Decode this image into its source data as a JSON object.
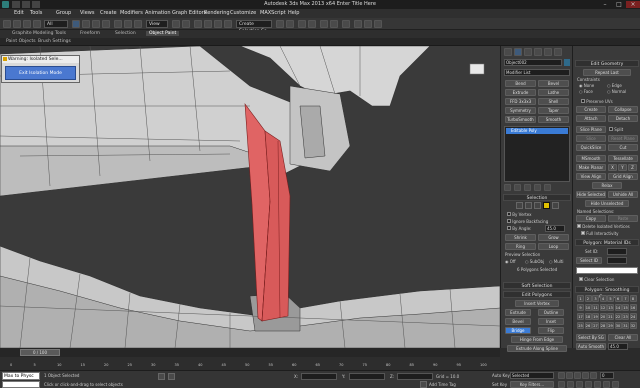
{
  "window": {
    "title": "Autodesk 3ds Max 2013 x64   Enter Title Here"
  },
  "menu": [
    "Edit",
    "Tools",
    "Group",
    "Views",
    "Create",
    "Modifiers",
    "Animation",
    "Graph Editors",
    "Rendering",
    "Customize",
    "MAXScript",
    "Help"
  ],
  "toolbar": {
    "selection_filter": "All",
    "view_dropdown": "View",
    "selection_set": "Create Selection Se"
  },
  "ribbon": {
    "tabs": [
      "Graphite Modeling Tools",
      "Freeform",
      "Selection",
      "Object Paint"
    ],
    "active_tab": "Object Paint",
    "subtabs": [
      "Paint Objects",
      "Brush Settings"
    ]
  },
  "warning": {
    "title": "Warning: Isolated Sele...",
    "button": "Exit Isolation Mode"
  },
  "command_panel": {
    "object_name": "Object002",
    "modifier_list": "Modifier List",
    "modifier_buttons": [
      "Bend",
      "Bevel",
      "Extrude",
      "Lathe",
      "FFD 3x3x3",
      "Shell",
      "Symmetry",
      "Taper",
      "TurboSmooth",
      "Smooth"
    ],
    "stack_item": "Editable Poly",
    "selection_header": "Selection",
    "by_vertex": "By Vertex",
    "ignore_backfacing": "Ignore Backfacing",
    "by_angle": "By Angle:",
    "by_angle_value": "45.0",
    "shrink": "Shrink",
    "grow": "Grow",
    "ring": "Ring",
    "loop": "Loop",
    "preview_selection": "Preview Selection",
    "preview_options": [
      "Off",
      "SubObj",
      "Multi"
    ],
    "selected_count": "6 Polygons Selected",
    "soft_selection": "Soft Selection",
    "edit_polygons_header": "Edit Polygons",
    "insert_vertex": "Insert Vertex",
    "extrude": "Extrude",
    "outline": "Outline",
    "bevel": "Bevel",
    "inset": "Inset",
    "bridge": "Bridge",
    "flip": "Flip",
    "hinge_from_edge": "Hinge From Edge",
    "extrude_along_spline": "Extrude Along Spline",
    "edit_triangulation": "Edit Triangulation",
    "retriangulate": "Retriangulate",
    "turn": "Turn"
  },
  "edit_geometry": {
    "header": "Edit Geometry",
    "repeat_last": "Repeat Last",
    "constraints": "Constraints",
    "constraint_options": [
      "None",
      "Edge",
      "Face",
      "Normal"
    ],
    "preserve_uvs": "Preserve UVs",
    "create": "Create",
    "collapse": "Collapse",
    "attach": "Attach",
    "detach": "Detach",
    "slice_plane": "Slice Plane",
    "split": "Split",
    "slice": "Slice",
    "reset_plane": "Reset Plane",
    "quickslice": "QuickSlice",
    "cut": "Cut",
    "msmooth": "MSmooth",
    "tessellate": "Tessellate",
    "make_planar": "Make Planar",
    "axes": [
      "X",
      "Y",
      "Z"
    ],
    "view_align": "View Align",
    "grid_align": "Grid Align",
    "relax": "Relax",
    "hide_selected": "Hide Selected",
    "unhide_all": "Unhide All",
    "hide_unselected": "Hide Unselected",
    "named_selections": "Named Selections:",
    "copy": "Copy",
    "paste": "Paste",
    "delete_isolated": "Delete Isolated Vertices",
    "full_interactivity": "Full Interactivity",
    "material_ids_header": "Polygon: Material IDs",
    "set_id": "Set ID:",
    "select_id": "Select ID",
    "clear_selection": "Clear Selection",
    "smoothing_groups_header": "Polygon: Smoothing Groups",
    "smoothing_numbers": [
      "1",
      "2",
      "3",
      "4",
      "5",
      "6",
      "7",
      "8",
      "9",
      "10",
      "11",
      "12",
      "13",
      "14",
      "15",
      "16",
      "17",
      "18",
      "19",
      "20",
      "21",
      "22",
      "23",
      "24",
      "25",
      "26",
      "27",
      "28",
      "29",
      "30",
      "31",
      "32"
    ],
    "select_by_sg": "Select By SG",
    "clear_all": "Clear All",
    "auto_smooth": "Auto Smooth",
    "auto_smooth_value": "45.0",
    "vertex_colors_header": "Polygon: Vertex Colors",
    "color_label": "Color:"
  },
  "timeline": {
    "frame": "0 / 100",
    "ticks": [
      "0",
      "5",
      "10",
      "15",
      "20",
      "25",
      "30",
      "35",
      "40",
      "45",
      "50",
      "55",
      "60",
      "65",
      "70",
      "75",
      "80",
      "85",
      "90",
      "95",
      "100"
    ]
  },
  "status": {
    "maxscript": "Max to Physc",
    "objects_selected": "1 Object Selected",
    "prompt": "Click or click-and-drag to select objects",
    "x_label": "X:",
    "y_label": "Y:",
    "z_label": "Z:",
    "grid": "Grid = 10.0",
    "add_time_tag": "Add Time Tag",
    "auto_key": "Auto Key",
    "auto_key_mode": "Selected",
    "set_key": "Set Key",
    "key_filters": "Key Filters...",
    "frame_value": "0"
  },
  "colors": {
    "accent": "#3a7bd5",
    "selection_red": "#e06464",
    "viewport_bg": "#3a3a3a"
  }
}
